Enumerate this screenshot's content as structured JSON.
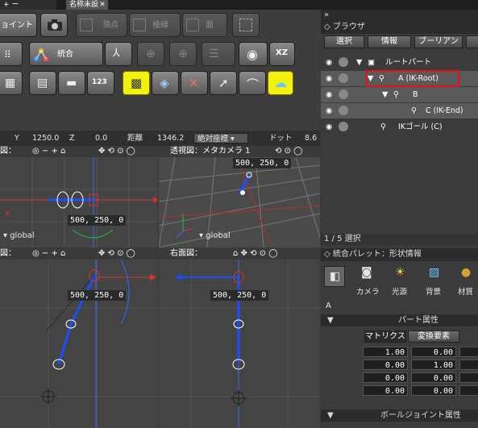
{
  "tabs": {
    "left": "+ ー",
    "active": "名称未設定",
    "close": "✕"
  },
  "toolbar": {
    "joint_label": "ョイント",
    "vertex_label": "頂点",
    "edge_label": "稜線",
    "face_label": "面",
    "merge_label": "統合",
    "xz_label": "XZ",
    "num_label": "123"
  },
  "coords": {
    "y_label": "Y",
    "y": "1250.0",
    "z_label": "Z",
    "z": "0.0",
    "dist_label": "距離",
    "dist": "1346.2",
    "mode": "絶対座標",
    "dot_label": "ドット",
    "dot": "8.6"
  },
  "viewports": {
    "top_left": {
      "title": "図：",
      "pos": "500, 250, 0",
      "scale": "global",
      "axis": "X"
    },
    "persp": {
      "title": "透視図：メタカメラ 1",
      "pos": "500, 250, 0",
      "scale": "global"
    },
    "front": {
      "title": "図：",
      "pos": "500, 250, 0"
    },
    "right": {
      "title": "右面図：",
      "pos": "500, 250, 0"
    }
  },
  "browser": {
    "title": "ブラウザ",
    "tabs": [
      "選択",
      "情報",
      "ブーリアン"
    ],
    "tree": [
      {
        "label": "ルートパート"
      },
      {
        "label": "A (IK-Root)"
      },
      {
        "label": "B"
      },
      {
        "label": "C (IK-End)"
      },
      {
        "label": "IKゴール (C)"
      }
    ],
    "status": "1 / 5 選択"
  },
  "palette": {
    "title": "統合パレット：形状情報",
    "items": [
      "カメラ",
      "光源",
      "背景",
      "材質"
    ],
    "object": "A",
    "section_title": "パート属性",
    "subtabs": [
      "マトリクス",
      "変換要素"
    ],
    "matrix": [
      [
        "1.00",
        "0.00"
      ],
      [
        "0.00",
        "1.00"
      ],
      [
        "0.00",
        "0.00"
      ],
      [
        "0.00",
        "0.00"
      ]
    ],
    "joint_title": "ボールジョイント属性"
  },
  "colors": {
    "highlight_box": "#e0141e",
    "selection_yellow": "#f2f20e",
    "bone_blue": "#1a4fff",
    "axis_red": "#e03030",
    "axis_green": "#20c040"
  }
}
